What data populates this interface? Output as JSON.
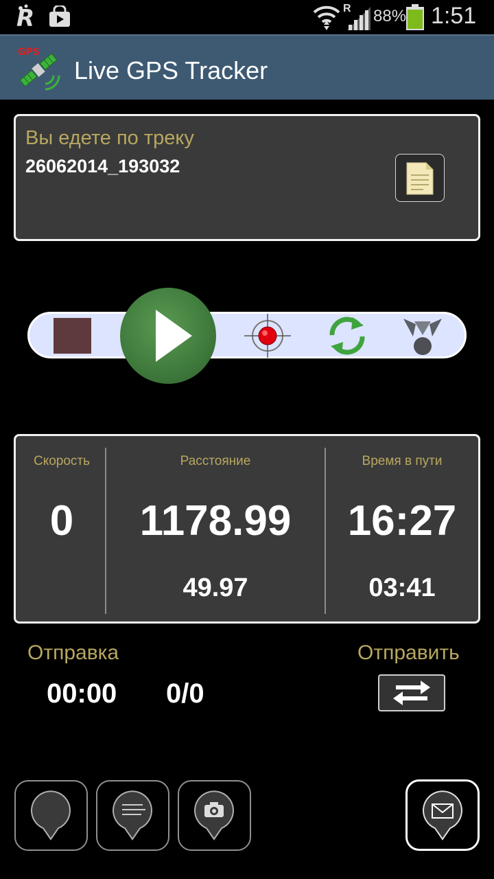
{
  "status_bar": {
    "battery": "88%",
    "time": "1:51",
    "roaming": "R"
  },
  "app": {
    "title": "Live GPS Tracker",
    "logo_text": "GPS"
  },
  "track": {
    "caption": "Вы едете по треку",
    "name": "26062014_193032"
  },
  "stats": {
    "speed": {
      "label": "Скорость",
      "value": "0"
    },
    "distance": {
      "label": "Расстояние",
      "value": "1178.99",
      "sub": "49.97"
    },
    "travel_time": {
      "label": "Время в пути",
      "value": "16:27",
      "sub": "03:41"
    }
  },
  "send": {
    "label": "Отправка",
    "timer": "00:00",
    "count": "0/0",
    "action_label": "Отправить"
  },
  "colors": {
    "accent_text": "#b8a760",
    "app_bar": "#3e5a73",
    "panel": "#3a3a3a",
    "control_bar": "#dde4ff"
  }
}
